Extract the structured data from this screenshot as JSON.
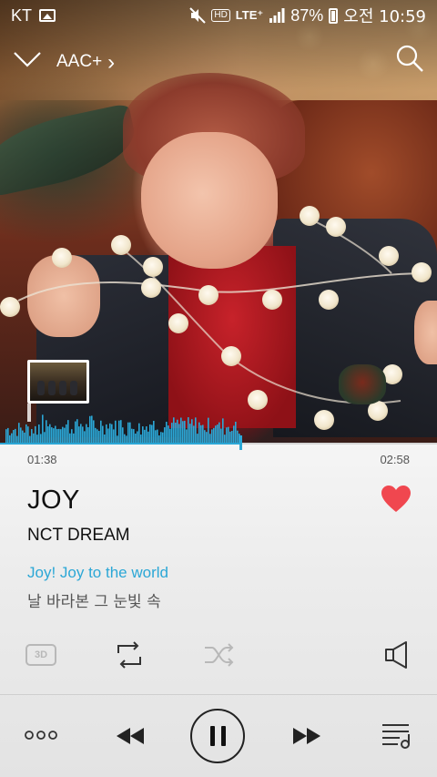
{
  "status_bar": {
    "carrier": "KT",
    "hd": "HD",
    "network": "LTE⁺",
    "battery": "87%",
    "time": "오전 10:59"
  },
  "header": {
    "format": "AAC+",
    "format_chevron": "›"
  },
  "player": {
    "elapsed": "01:38",
    "total": "02:58",
    "progress_fraction": 0.55,
    "title": "JOY",
    "artist": "NCT DREAM",
    "favorited": true,
    "lyrics_current": "Joy! Joy to the world",
    "lyrics_next": "날 바라본 그 눈빛 속",
    "sound_effect_label": "3D"
  },
  "icons": {
    "collapse": "chevron-down-icon",
    "search": "search-icon",
    "favorite": "heart-icon",
    "repeat": "repeat-icon",
    "shuffle": "shuffle-icon",
    "speaker": "speaker-icon",
    "more": "more-icon",
    "previous": "rewind-icon",
    "pause": "pause-icon",
    "next": "fast-forward-icon",
    "playlist": "playlist-icon"
  },
  "colors": {
    "accent": "#2ba7d6",
    "heart": "#f0474f",
    "disabled_icon": "#b8b8b8"
  }
}
